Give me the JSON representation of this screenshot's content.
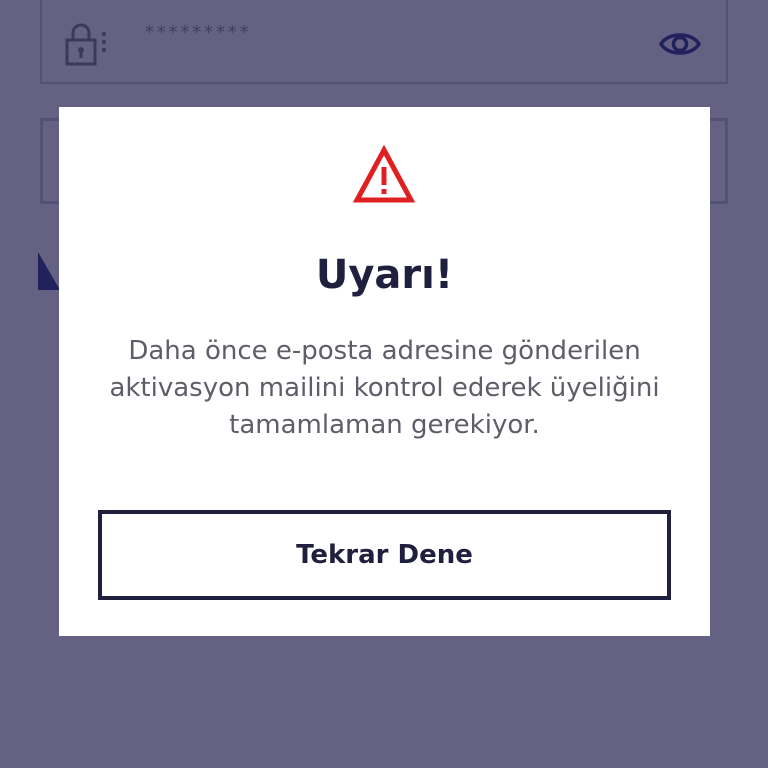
{
  "background": {
    "password_field": {
      "value": "*********",
      "lock_icon": "lock-icon",
      "visibility_icon": "eye-icon"
    }
  },
  "colors": {
    "overlay": "#221e4e",
    "title": "#1f1f3e",
    "message": "#5e5e68",
    "warning_red": "#e02020",
    "eye_blue": "#1f2a7a"
  },
  "modal": {
    "icon": "warning-icon",
    "title": "Uyarı!",
    "message": "Daha önce e-posta adresine gönderilen aktivasyon mailini kontrol ederek üyeliğini tamamlaman gerekiyor.",
    "button_label": "Tekrar Dene"
  }
}
